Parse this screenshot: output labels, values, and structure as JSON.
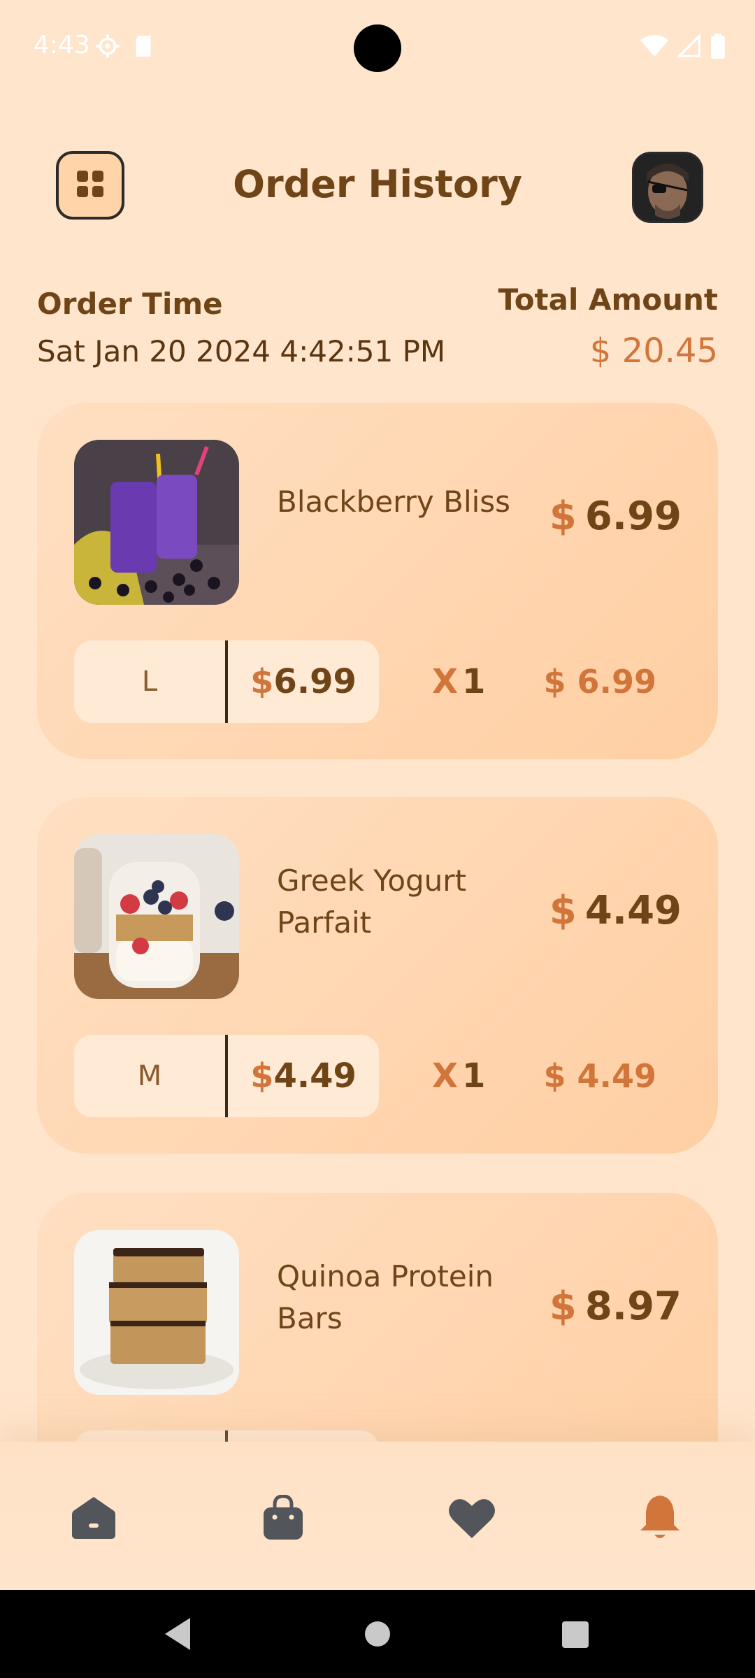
{
  "status_bar": {
    "time": "4:43"
  },
  "header": {
    "title": "Order History"
  },
  "order": {
    "time_label": "Order Time",
    "time_value": "Sat Jan 20 2024 4:42:51 PM",
    "total_label": "Total Amount",
    "total_value": "$ 20.45"
  },
  "items": [
    {
      "name": "Blackberry Bliss",
      "price_currency": "$",
      "price": "6.99",
      "size": "L",
      "size_currency": "$",
      "size_price": "6.99",
      "qty_prefix": "X",
      "qty": "1",
      "line_total": "$ 6.99"
    },
    {
      "name": "Greek Yogurt Parfait",
      "price_currency": "$",
      "price": "4.49",
      "size": "M",
      "size_currency": "$",
      "size_price": "4.49",
      "qty_prefix": "X",
      "qty": "1",
      "line_total": "$ 4.49"
    },
    {
      "name": "Quinoa Protein Bars",
      "price_currency": "$",
      "price": "8.97"
    }
  ],
  "bottom_nav": {
    "items": [
      "home-icon",
      "bag-icon",
      "heart-icon",
      "bell-icon"
    ],
    "active": "bell-icon",
    "inactive_color": "#52555A",
    "active_color": "#D2753B"
  },
  "colors": {
    "background": "#FFE5CC",
    "accent": "#D2753B",
    "text_brown": "#6F4518"
  }
}
